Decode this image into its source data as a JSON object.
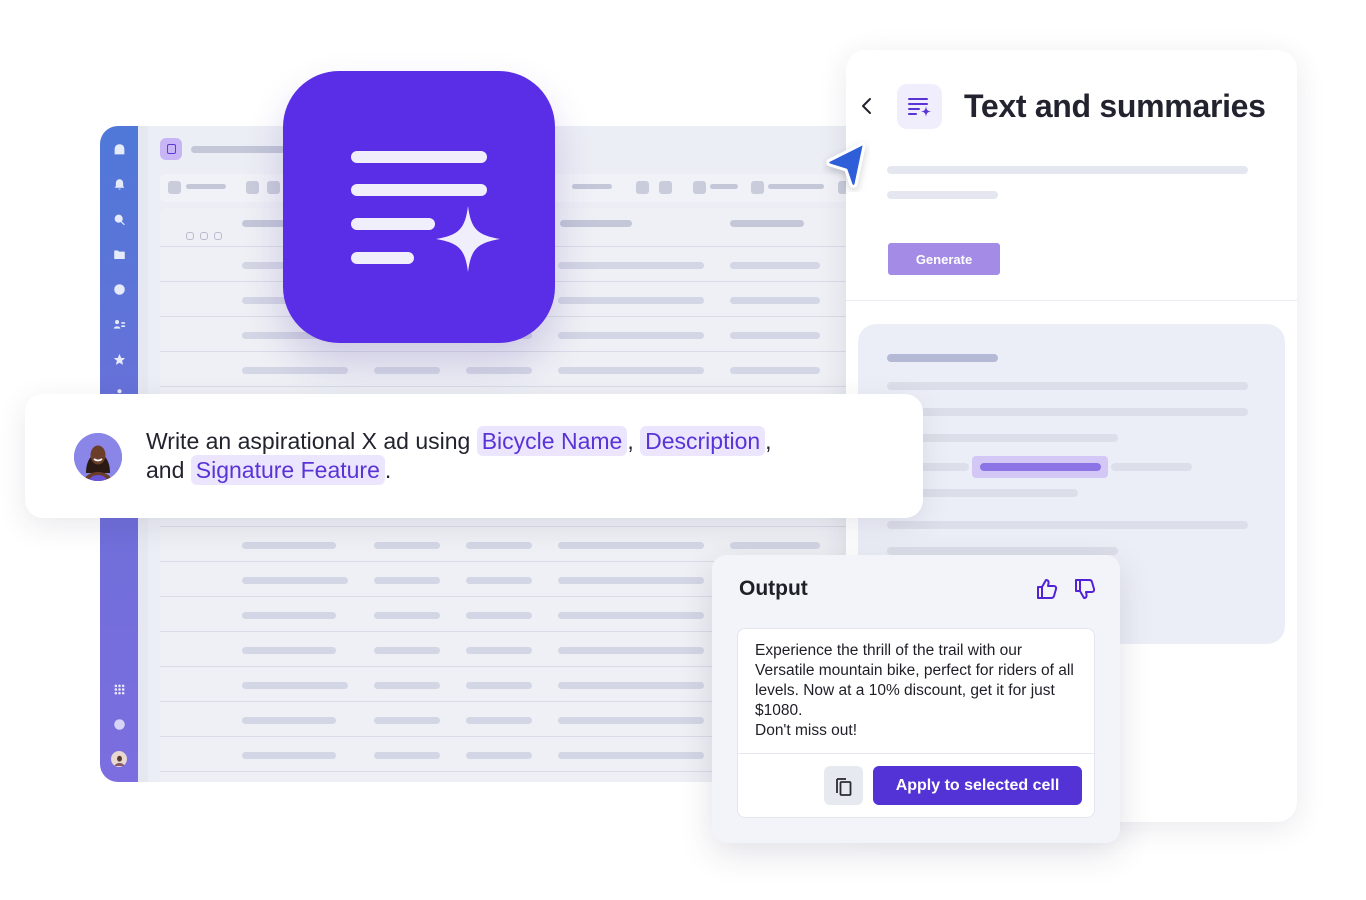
{
  "panel": {
    "title": "Text and summaries",
    "back_icon": "chevron-left-icon",
    "feature_icon": "text-sparkle-icon",
    "generate_label": "Generate"
  },
  "prompt": {
    "avatar": "user-avatar",
    "text_before": "Write an aspirational X ad using ",
    "field_1": "Bicycle Name",
    "sep_1": ", ",
    "field_2": "Description",
    "sep_2": ",",
    "text_and": " and ",
    "field_3": "Signature Feature",
    "text_end": "."
  },
  "output": {
    "title": "Output",
    "thumbs_up_icon": "thumbs-up-icon",
    "thumbs_down_icon": "thumbs-down-icon",
    "text": "Experience the thrill of the trail with our Versatile mountain bike, perfect for riders of all levels. Now at a 10% discount, get it for just $1080.\nDon't miss out!",
    "copy_icon": "copy-icon",
    "apply_label": "Apply to selected cell"
  },
  "sidebar": {
    "icons": [
      "home-icon",
      "bell-icon",
      "search-icon",
      "folder-icon",
      "clock-icon",
      "contacts-icon",
      "star-icon",
      "apps-icon",
      "grid-icon",
      "help-icon",
      "profile-avatar"
    ]
  },
  "colors": {
    "brand_purple": "#5a2ee6",
    "apply_button": "#5433d6",
    "generate_button": "#a38be6",
    "chip_bg": "#ebe6fd",
    "chip_text": "#5a33d6",
    "cursor_blue": "#2d5fd9"
  }
}
